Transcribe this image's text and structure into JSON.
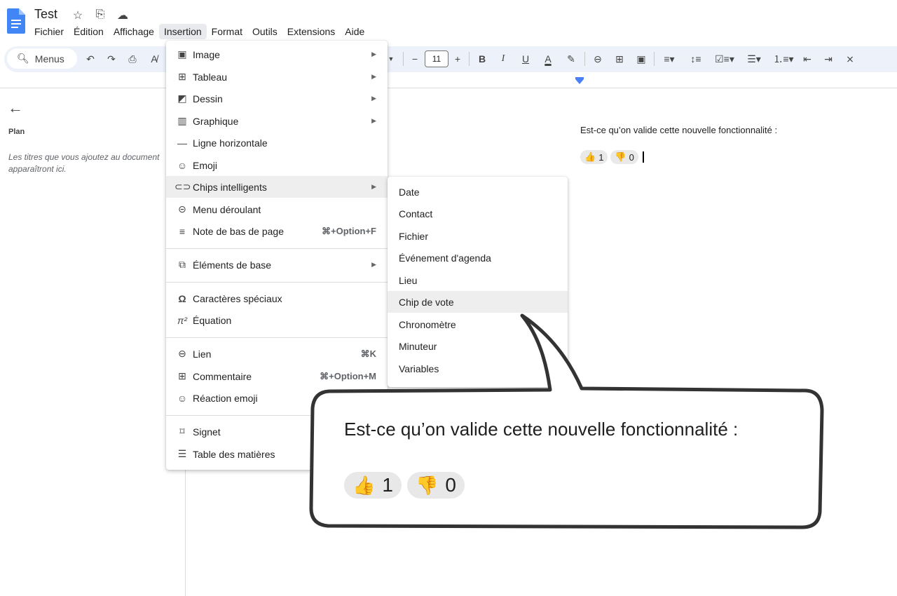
{
  "document": {
    "title": "Test",
    "question": "Est-ce qu’on valide cette nouvelle fonctionnalité :",
    "votes": {
      "up_count": "1",
      "down_count": "0"
    }
  },
  "menubar": [
    "Fichier",
    "Édition",
    "Affichage",
    "Insertion",
    "Format",
    "Outils",
    "Extensions",
    "Aide"
  ],
  "toolbar": {
    "search_label": "Menus",
    "font_size": "11"
  },
  "sidebar": {
    "plan_label": "Plan",
    "hint": "Les titres que vous ajoutez au document apparaîtront ici."
  },
  "insertion_menu": [
    {
      "label": "Image",
      "icon": "image-icon",
      "submenu": true
    },
    {
      "label": "Tableau",
      "icon": "table-icon",
      "submenu": true
    },
    {
      "label": "Dessin",
      "icon": "drawing-icon",
      "submenu": true
    },
    {
      "label": "Graphique",
      "icon": "chart-icon",
      "submenu": true
    },
    {
      "label": "Ligne horizontale",
      "icon": "horizontal-line-icon"
    },
    {
      "label": "Emoji",
      "icon": "emoji-icon"
    },
    {
      "label": "Chips intelligents",
      "icon": "smart-chip-icon",
      "submenu": true
    },
    {
      "label": "Menu déroulant",
      "icon": "dropdown-icon"
    },
    {
      "label": "Note de bas de page",
      "icon": "footnote-icon",
      "shortcut": "⌘+Option+F"
    },
    {
      "label": "Éléments de base",
      "icon": "building-blocks-icon",
      "submenu": true
    },
    {
      "label": "Caractères spéciaux",
      "icon": "omega-icon"
    },
    {
      "label": "Équation",
      "icon": "pi-icon"
    },
    {
      "label": "Lien",
      "icon": "link-icon",
      "shortcut": "⌘K"
    },
    {
      "label": "Commentaire",
      "icon": "comment-icon",
      "shortcut": "⌘+Option+M"
    },
    {
      "label": "Réaction emoji",
      "icon": "emoji-reaction-icon"
    },
    {
      "label": "Signet",
      "icon": "bookmark-icon"
    },
    {
      "label": "Table des matières",
      "icon": "toc-icon"
    }
  ],
  "smart_chips_submenu": [
    "Date",
    "Contact",
    "Fichier",
    "Événement d'agenda",
    "Lieu",
    "Chip de vote",
    "Chronomètre",
    "Minuteur",
    "Variables"
  ],
  "callout": {
    "text": "Est-ce qu’on valide cette nouvelle fonctionnalité :",
    "up_count": "1",
    "down_count": "0"
  }
}
